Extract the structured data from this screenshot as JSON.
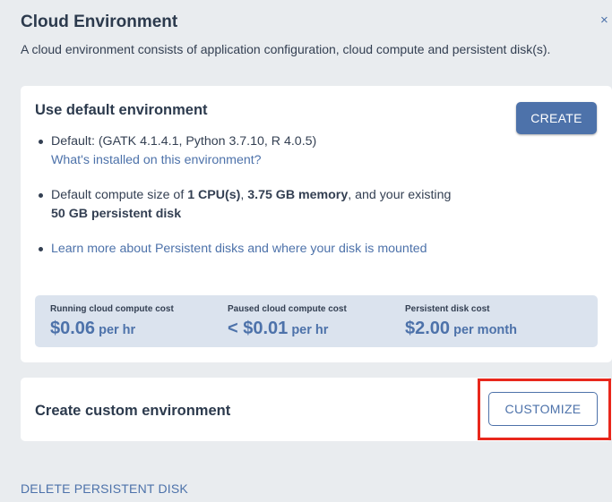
{
  "panel": {
    "title": "Cloud Environment",
    "close_icon": "×",
    "description": "A cloud environment consists of application configuration, cloud compute and persistent disk(s)."
  },
  "default_env": {
    "title": "Use default environment",
    "create_label": "CREATE",
    "bullet1_text": "Default: (GATK 4.1.4.1, Python 3.7.10, R 4.0.5)",
    "bullet1_link": "What's installed on this environment?",
    "bullet2_pre": "Default compute size of ",
    "bullet2_cpu": "1 CPU(s)",
    "bullet2_sep": ", ",
    "bullet2_mem": "3.75 GB memory",
    "bullet2_mid": ", and your existing ",
    "bullet2_disk": "50 GB persistent disk",
    "bullet3_link": "Learn more about Persistent disks and where your disk is mounted"
  },
  "costs": [
    {
      "label": "Running cloud compute cost",
      "amount": "$0.06",
      "unit": " per hr"
    },
    {
      "label": "Paused cloud compute cost",
      "amount": "< $0.01",
      "unit": " per hr"
    },
    {
      "label": "Persistent disk cost",
      "amount": "$2.00",
      "unit": " per month"
    }
  ],
  "custom_env": {
    "title": "Create custom environment",
    "customize_label": "CUSTOMIZE"
  },
  "footer": {
    "delete_label": "DELETE PERSISTENT DISK"
  },
  "colors": {
    "accent": "#4d72aa",
    "highlight": "#e8271c",
    "cost_bg": "#dbe3ee"
  }
}
